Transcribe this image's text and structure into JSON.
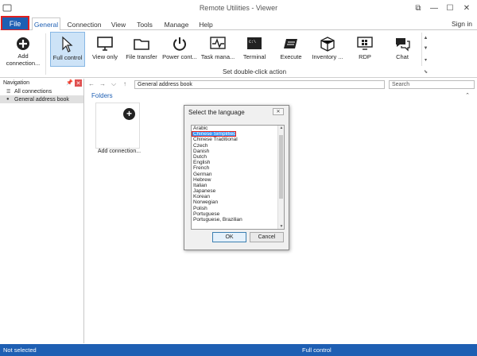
{
  "window": {
    "title": "Remote Utilities - Viewer",
    "minimize": "—",
    "maximize": "☐",
    "close": "✕",
    "restore": "⧉"
  },
  "tabs": {
    "file": "File",
    "general": "General",
    "connection": "Connection",
    "view": "View",
    "tools": "Tools",
    "manage": "Manage",
    "help": "Help",
    "signin": "Sign in"
  },
  "ribbon": {
    "add_connection": "Add connection...",
    "full_control": "Full control",
    "view_only": "View only",
    "file_transfer": "File transfer",
    "power_control": "Power cont...",
    "task_manager": "Task mana...",
    "terminal": "Terminal",
    "execute": "Execute",
    "inventory": "Inventory ...",
    "rdp": "RDP",
    "chat": "Chat",
    "group_label": "Set double-click action"
  },
  "navigation": {
    "title": "Navigation",
    "items": [
      "All connections",
      "General address book"
    ]
  },
  "main": {
    "address": "General address book",
    "search_placeholder": "Search",
    "folders_label": "Folders",
    "tile_label": "Add connection..."
  },
  "dialog": {
    "title": "Select the language",
    "languages": [
      "Arabic",
      "Chinese Simplified",
      "Chinese Traditional",
      "Czech",
      "Danish",
      "Dutch",
      "English",
      "French",
      "German",
      "Hebrew",
      "Italian",
      "Japanese",
      "Korean",
      "Norwegian",
      "Polish",
      "Portuguese",
      "Portuguese, Brazilian"
    ],
    "selected": "Chinese Simplified",
    "ok": "OK",
    "cancel": "Cancel"
  },
  "status": {
    "left": "Not selected",
    "mode": "Full control"
  }
}
